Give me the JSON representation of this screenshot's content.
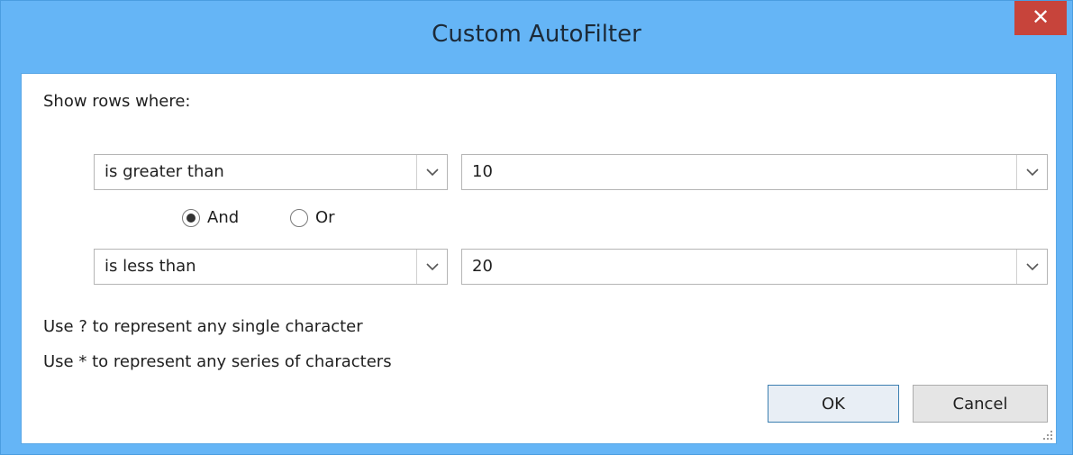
{
  "window": {
    "title": "Custom AutoFilter",
    "close_glyph": "✕"
  },
  "prompt": "Show rows where:",
  "criteria": [
    {
      "operator": "is greater than",
      "value": "10"
    },
    {
      "operator": "is less than",
      "value": "20"
    }
  ],
  "logic": {
    "and_label": "And",
    "or_label": "Or",
    "selected": "And"
  },
  "hints": [
    "Use ? to represent any single character",
    "Use * to represent any series of characters"
  ],
  "buttons": {
    "ok": "OK",
    "cancel": "Cancel"
  },
  "icons": {
    "dropdown": "chevron-down-icon",
    "close": "close-icon",
    "grip": "resize-grip-icon"
  },
  "colors": {
    "titlebar": "#65b5f6",
    "close": "#c7443b",
    "default_button_border": "#3c7fb1"
  }
}
